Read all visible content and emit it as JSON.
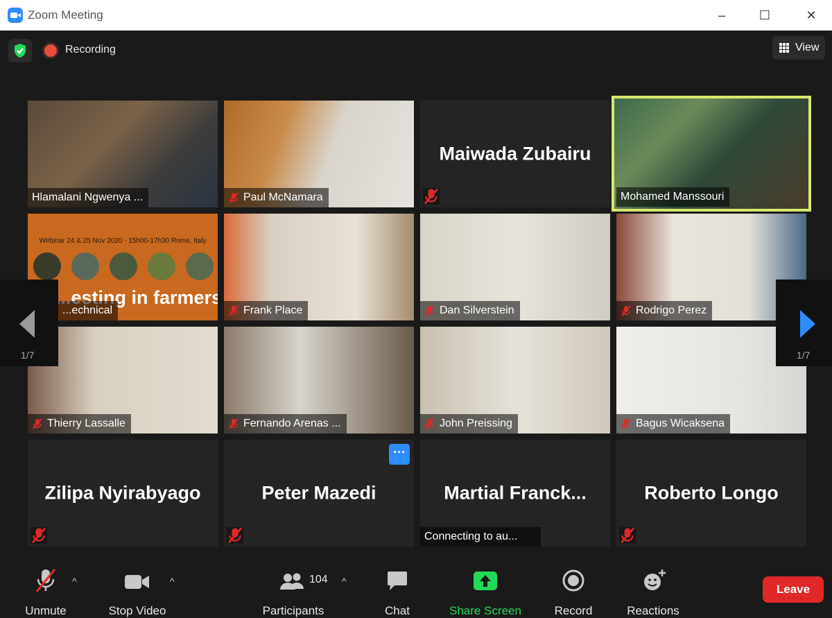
{
  "window": {
    "title": "Zoom Meeting",
    "minimize": "–",
    "maximize": "☐",
    "close": "✕"
  },
  "topbar": {
    "recording_label": "Recording",
    "view_label": "View"
  },
  "nav": {
    "page_left": "1/7",
    "page_right": "1/7"
  },
  "tiles": [
    {
      "name": "Hlamalani Ngwenya ...",
      "muted": false,
      "video": true
    },
    {
      "name": "Paul McNamara",
      "muted": true,
      "video": true
    },
    {
      "name": "Maiwada Zubairu",
      "muted": true,
      "video": false
    },
    {
      "name": "Mohamed Manssouri",
      "muted": false,
      "video": true,
      "active": true
    },
    {
      "name": "...echnical",
      "muted": false,
      "video": true,
      "slide_text": "...esting in farmers",
      "slide_subtitle": "Webinar 24 & 25 Nov 2020 · 15h00-17h30 Rome, Italy"
    },
    {
      "name": "Frank Place",
      "muted": true,
      "video": true
    },
    {
      "name": "Dan Silverstein",
      "muted": true,
      "video": true
    },
    {
      "name": "Rodrigo Perez",
      "muted": true,
      "video": true
    },
    {
      "name": "Thierry Lassalle",
      "muted": true,
      "video": true
    },
    {
      "name": "Fernando Arenas ...",
      "muted": true,
      "video": true
    },
    {
      "name": "John Preissing",
      "muted": true,
      "video": true
    },
    {
      "name": "Bagus Wicaksena",
      "muted": true,
      "video": true
    },
    {
      "name": "Zilipa Nyirabyago",
      "muted": true,
      "video": false
    },
    {
      "name": "Peter Mazedi",
      "muted": true,
      "video": false,
      "more_label": "···"
    },
    {
      "name": "Martial  Franck...",
      "muted": false,
      "video": false,
      "status": "Connecting to au..."
    },
    {
      "name": "Roberto Longo",
      "muted": true,
      "video": false
    }
  ],
  "toolbar": {
    "unmute": "Unmute",
    "stop_video": "Stop Video",
    "participants": "Participants",
    "participants_count": "104",
    "chat": "Chat",
    "share_screen": "Share Screen",
    "record": "Record",
    "reactions": "Reactions",
    "leave": "Leave"
  },
  "colors": {
    "accent": "#2d8cff",
    "active_speaker": "#d7e86b",
    "share_green": "#23d959",
    "leave_red": "#e02828",
    "mute_red": "#e02828"
  }
}
